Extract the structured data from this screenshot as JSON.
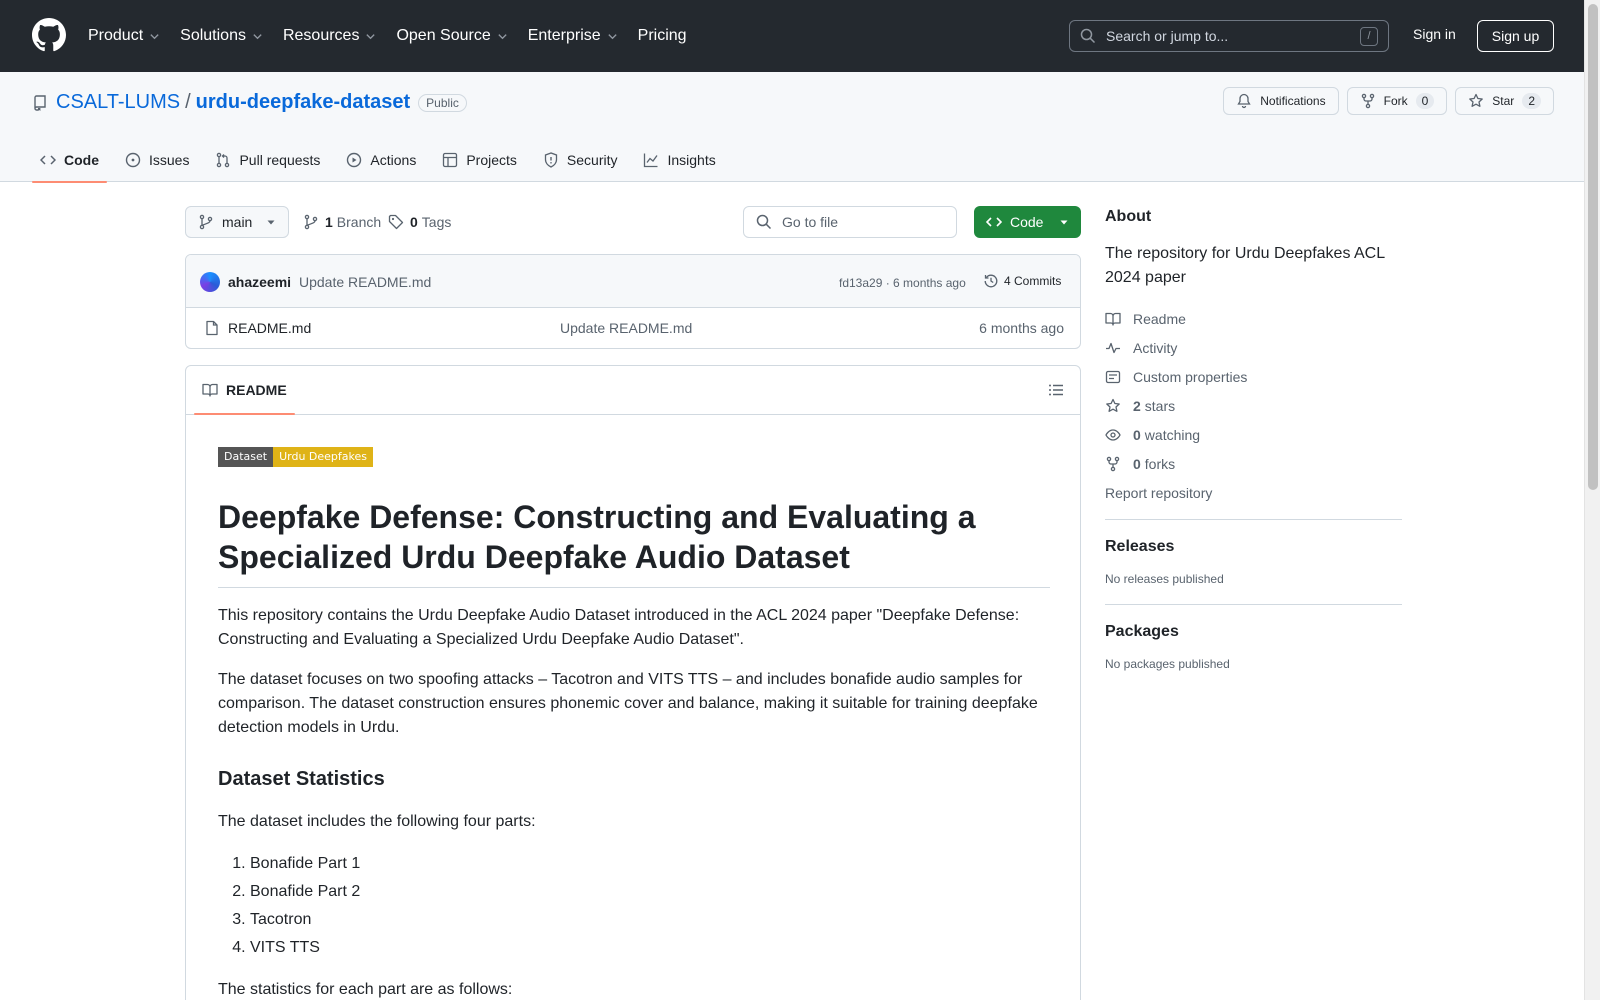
{
  "header": {
    "nav": [
      "Product",
      "Solutions",
      "Resources",
      "Open Source",
      "Enterprise",
      "Pricing"
    ],
    "search_placeholder": "Search or jump to...",
    "search_shortcut": "/",
    "sign_in": "Sign in",
    "sign_up": "Sign up"
  },
  "repo": {
    "owner": "CSALT-LUMS",
    "separator": "/",
    "name": "urdu-deepfake-dataset",
    "visibility": "Public",
    "notifications_label": "Notifications",
    "fork_label": "Fork",
    "fork_count": "0",
    "star_label": "Star",
    "star_count": "2"
  },
  "tabs": [
    "Code",
    "Issues",
    "Pull requests",
    "Actions",
    "Projects",
    "Security",
    "Insights"
  ],
  "filenav": {
    "branch": "main",
    "branch_count": "1",
    "branch_label": "Branch",
    "tag_count": "0",
    "tag_label": "Tags",
    "go_to_file": "Go to file",
    "code_button": "Code"
  },
  "commit": {
    "author": "ahazeemi",
    "message": "Update README.md",
    "meta": "fd13a29 · 6 months ago",
    "commits_label": "4 Commits"
  },
  "files": [
    {
      "name": "README.md",
      "message": "Update README.md",
      "age": "6 months ago"
    }
  ],
  "readme": {
    "tab_label": "README",
    "badge_left": "Dataset",
    "badge_right": "Urdu Deepfakes",
    "title": "Deepfake Defense: Constructing and Evaluating a Specialized Urdu Deepfake Audio Dataset",
    "p1": "This repository contains the Urdu Deepfake Audio Dataset introduced in the ACL 2024 paper \"Deepfake Defense: Constructing and Evaluating a Specialized Urdu Deepfake Audio Dataset\".",
    "p2": "The dataset focuses on two spoofing attacks – Tacotron and VITS TTS – and includes bonafide audio samples for comparison. The dataset construction ensures phonemic cover and balance, making it suitable for training deepfake detection models in Urdu.",
    "h2": "Dataset Statistics",
    "p3": "The dataset includes the following four parts:",
    "list": [
      "Bonafide Part 1",
      "Bonafide Part 2",
      "Tacotron",
      "VITS TTS"
    ],
    "p4": "The statistics for each part are as follows:"
  },
  "sidebar": {
    "about_title": "About",
    "description": "The repository for Urdu Deepfakes ACL 2024 paper",
    "readme": "Readme",
    "activity": "Activity",
    "custom_properties": "Custom properties",
    "stars_count": "2",
    "stars_label": "stars",
    "watching_count": "0",
    "watching_label": "watching",
    "forks_count": "0",
    "forks_label": "forks",
    "report": "Report repository",
    "releases_title": "Releases",
    "releases_empty": "No releases published",
    "packages_title": "Packages",
    "packages_empty": "No packages published"
  }
}
